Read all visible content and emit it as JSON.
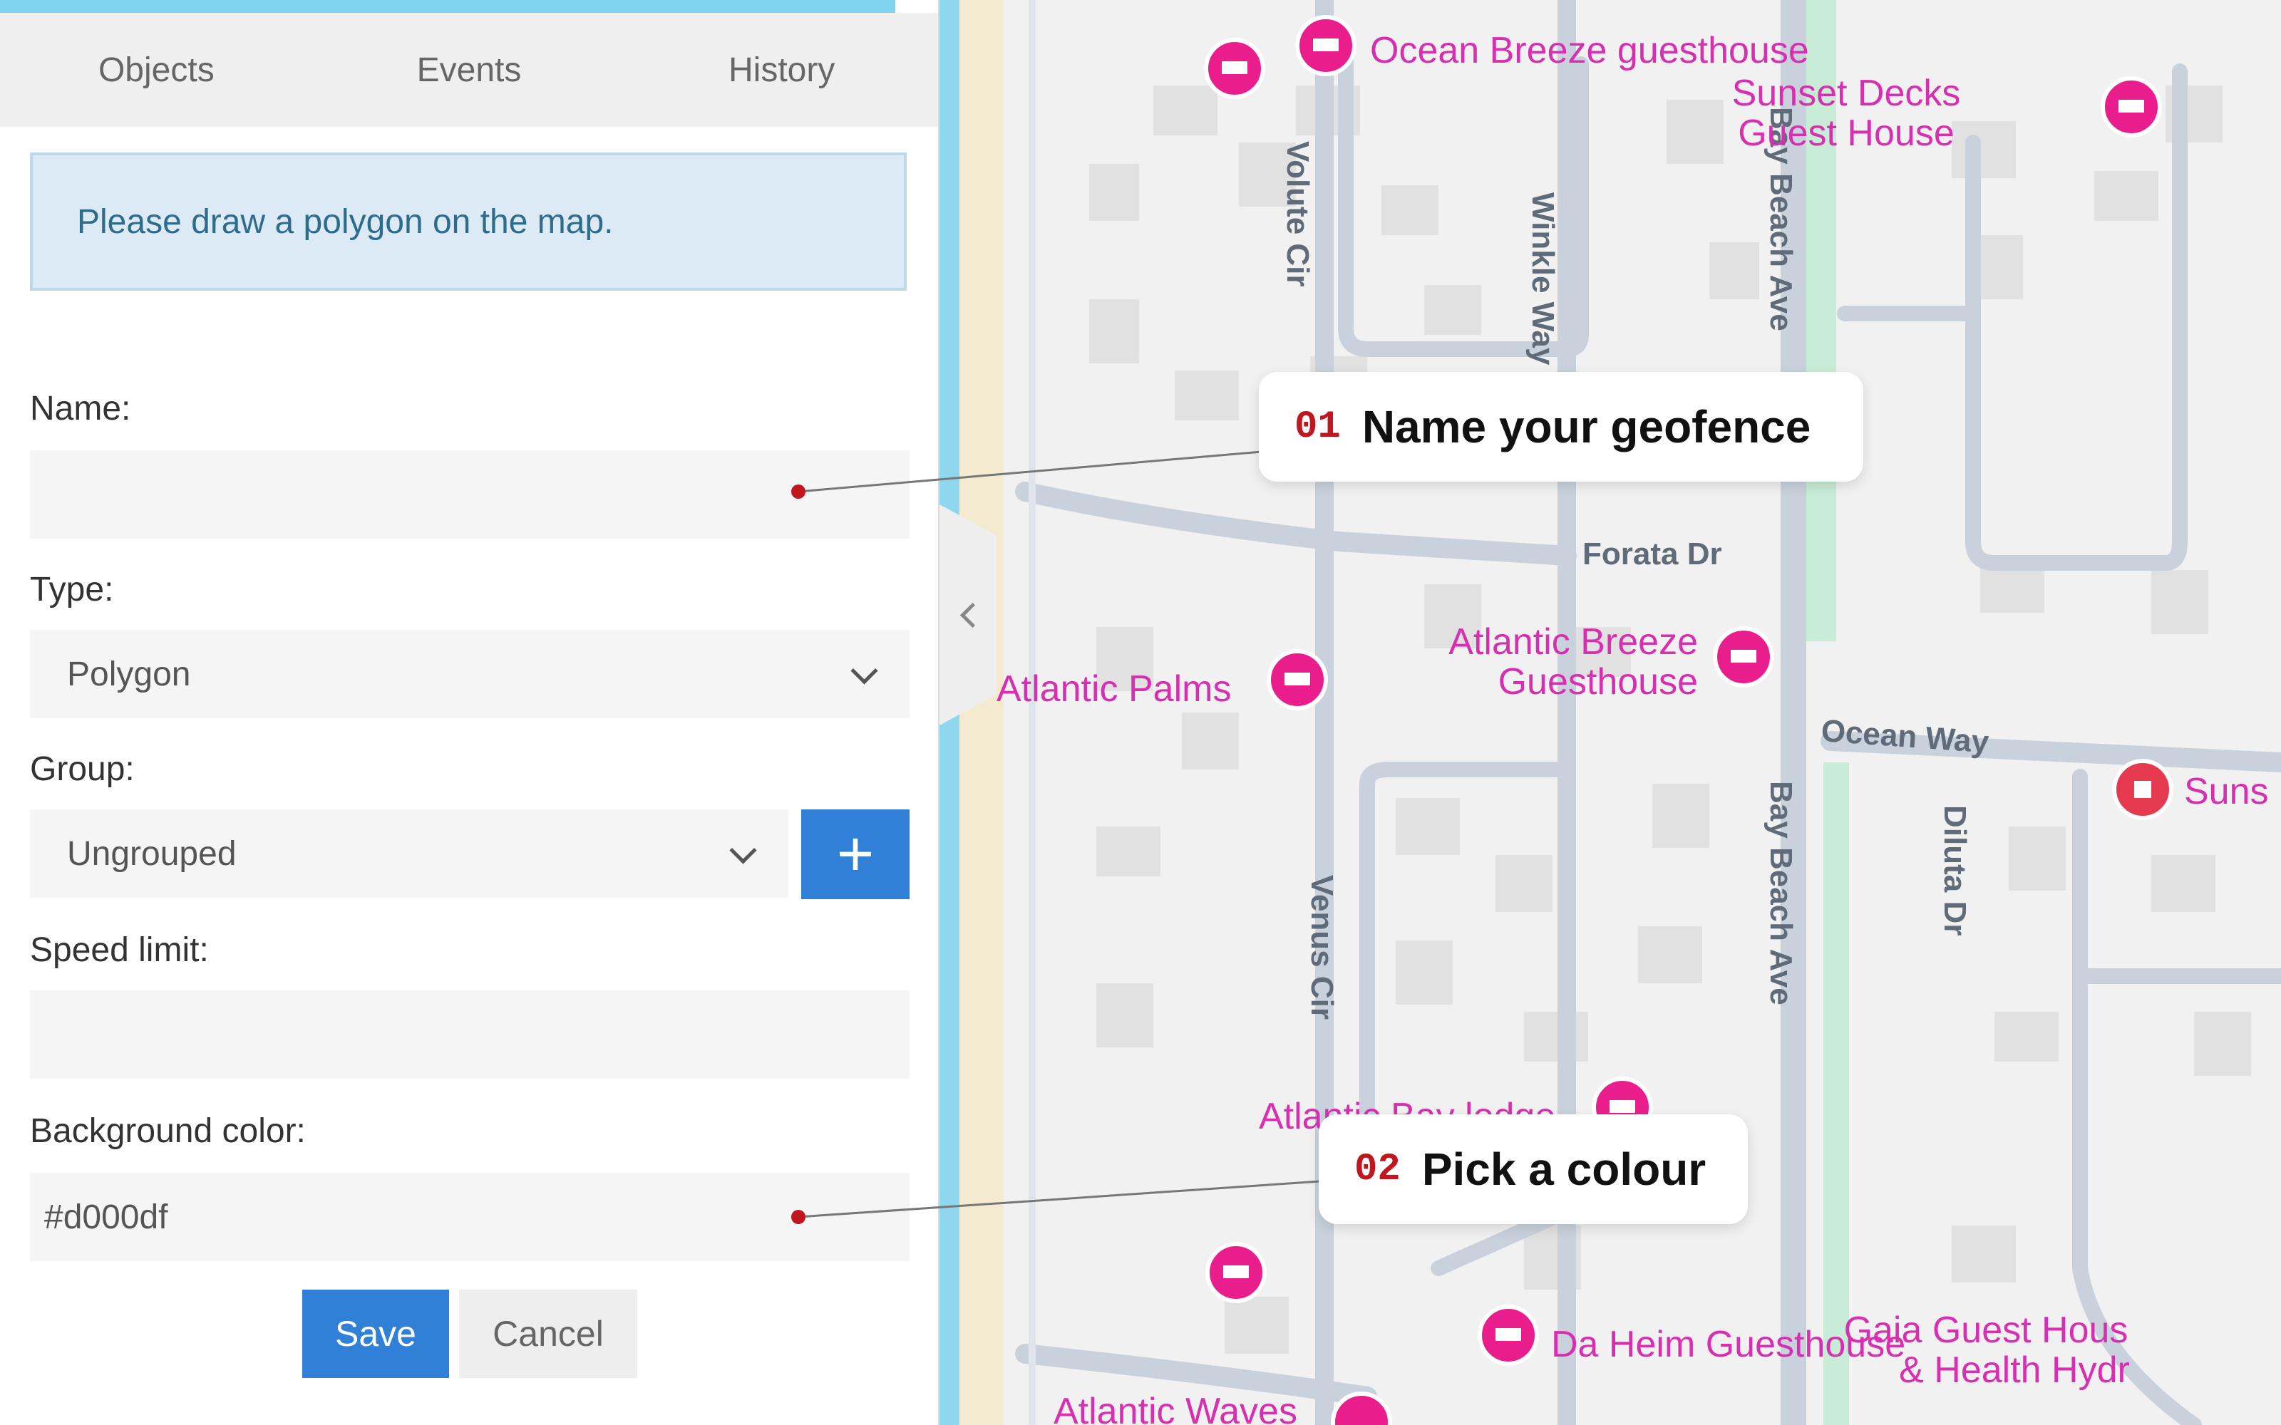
{
  "colors": {
    "accent": "#2f80d6",
    "poi": "#e91e8c",
    "callout_number": "#c0161f",
    "alert_bg": "#dbeaf5"
  },
  "tabs": [
    {
      "label": "Objects"
    },
    {
      "label": "Events"
    },
    {
      "label": "History"
    }
  ],
  "alert": {
    "message": "Please draw a polygon on the map."
  },
  "form": {
    "name_label": "Name:",
    "name_value": "",
    "type_label": "Type:",
    "type_value": "Polygon",
    "group_label": "Group:",
    "group_value": "Ungrouped",
    "add_group_icon": "plus-icon",
    "speed_label": "Speed limit:",
    "speed_value": "",
    "bg_color_label": "Background color:",
    "bg_color_value": "#d000df",
    "save_label": "Save",
    "cancel_label": "Cancel"
  },
  "callouts": [
    {
      "number": "01",
      "text": "Name your geofence"
    },
    {
      "number": "02",
      "text": "Pick a colour"
    }
  ],
  "map": {
    "streets": [
      "Volute Cir",
      "Winkle Way",
      "Bay Beach Ave",
      "Forata Dr",
      "Ocean Way",
      "Venus Cir",
      "Bay Beach Ave",
      "Diluta Dr"
    ],
    "pois": [
      {
        "name": "Ocean Breeze guesthouse",
        "icon": "hotel-icon"
      },
      {
        "name": "Sunset Decks",
        "line2": "Guest House",
        "icon": "hotel-icon"
      },
      {
        "name": "Atlantic Palms",
        "icon": "hotel-icon"
      },
      {
        "name": "Atlantic Breeze",
        "line2": "Guesthouse",
        "icon": "hotel-icon"
      },
      {
        "name": "Suns",
        "icon": "hospital-icon"
      },
      {
        "name": "Atlantic Bay lodge",
        "icon": "hotel-icon"
      },
      {
        "name": "Da Heim Guesthouse",
        "icon": "hotel-icon"
      },
      {
        "name": "Gaia Guest Hous",
        "line2": "& Health Hydr",
        "icon": "hotel-icon"
      },
      {
        "name": "Atlantic Waves",
        "icon": "hotel-icon"
      }
    ]
  }
}
